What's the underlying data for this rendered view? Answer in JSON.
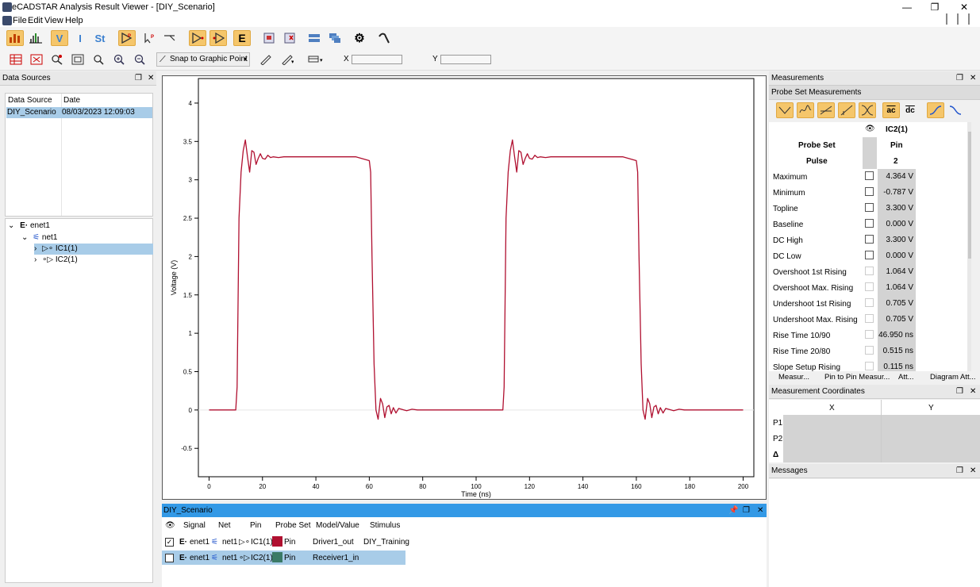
{
  "window": {
    "title": "eCADSTAR Analysis Result Viewer - [DIY_Scenario]",
    "controls": [
      "—",
      "❐",
      "✕"
    ]
  },
  "menu": [
    "File",
    "Edit",
    "View",
    "Help"
  ],
  "toolbar": {
    "snap_label": "Snap to Graphic Point",
    "x_label": "X",
    "y_label": "Y",
    "v_label": "V",
    "i_label": "I",
    "st_label": "St",
    "e_label": "E"
  },
  "data_sources": {
    "title": "Data Sources",
    "headers": [
      "Data Source",
      "Date"
    ],
    "rows": [
      {
        "source": "DIY_Scenario",
        "date": "08/03/2023 12:09:03"
      }
    ]
  },
  "tree": {
    "root": "enet1",
    "net": "net1",
    "items": [
      "IC1(1)",
      "IC2(1)"
    ]
  },
  "chart_data": {
    "type": "line",
    "xlabel": "Time (ns)",
    "ylabel": "Voltage (V)",
    "xlim": [
      -4,
      204
    ],
    "ylim": [
      -0.87,
      4.32
    ],
    "xticks": [
      0,
      20,
      40,
      60,
      80,
      100,
      120,
      140,
      160,
      180,
      200
    ],
    "yticks": [
      -0.5,
      0,
      0.5,
      1,
      1.5,
      2,
      2.5,
      3,
      3.5,
      4
    ],
    "color": "#b01030",
    "series": [
      {
        "x": [
          0,
          10,
          10.5,
          11.2,
          12,
          12.8,
          13.6,
          14.4,
          15.2,
          16,
          16.8,
          17.6,
          18.4,
          19.2,
          20,
          21,
          22,
          23,
          24,
          26,
          28,
          30,
          40,
          55,
          60,
          60.5,
          61,
          61.8,
          62.5,
          63.3,
          64.2,
          65,
          65.8,
          66.6,
          67.4,
          68.2,
          69,
          70,
          71,
          72,
          74,
          76,
          78,
          80,
          100,
          110,
          110.5,
          111.2,
          112,
          112.8,
          113.6,
          114.4,
          115.2,
          116,
          116.8,
          117.6,
          118.4,
          119.2,
          120,
          121,
          122,
          123,
          124,
          126,
          128,
          130,
          140,
          155,
          160,
          160.5,
          161,
          161.8,
          162.5,
          163.3,
          164.2,
          165,
          165.8,
          166.6,
          167.4,
          168.2,
          169,
          170,
          171,
          172,
          174,
          176,
          178,
          180,
          200
        ],
        "y": [
          0,
          0,
          0.3,
          2.5,
          3.1,
          3.38,
          3.52,
          3.3,
          3.1,
          3.38,
          3.36,
          3.2,
          3.28,
          3.34,
          3.28,
          3.27,
          3.32,
          3.29,
          3.3,
          3.29,
          3.3,
          3.3,
          3.3,
          3.3,
          3.25,
          3.1,
          2.0,
          0.6,
          0.0,
          -0.12,
          0.15,
          0.08,
          -0.1,
          0.04,
          0.06,
          -0.05,
          0.03,
          -0.04,
          0.02,
          0.01,
          -0.01,
          0.01,
          0,
          0,
          0,
          0,
          0.3,
          2.5,
          3.1,
          3.38,
          3.52,
          3.3,
          3.1,
          3.38,
          3.36,
          3.2,
          3.28,
          3.34,
          3.28,
          3.27,
          3.32,
          3.29,
          3.3,
          3.29,
          3.3,
          3.3,
          3.3,
          3.3,
          3.25,
          3.1,
          2.0,
          0.6,
          0.0,
          -0.12,
          0.15,
          0.08,
          -0.1,
          0.04,
          0.06,
          -0.05,
          0.03,
          -0.04,
          0.02,
          0.01,
          -0.01,
          0.01,
          0,
          0,
          0
        ]
      }
    ]
  },
  "bottom_panel": {
    "title": "DIY_Scenario",
    "headers": [
      "Signal",
      "Net",
      "Pin",
      "Probe Set",
      "Model/Value",
      "Stimulus"
    ],
    "rows": [
      {
        "signal": "enet1",
        "net": "net1",
        "pin": "IC1(1)",
        "probe": "Pin",
        "model": "Driver1_out",
        "stimulus": "DIY_Training",
        "checked": true,
        "swatch": "#b01030"
      },
      {
        "signal": "enet1",
        "net": "net1",
        "pin": "IC2(1)",
        "probe": "Pin",
        "model": "Receiver1_in",
        "stimulus": "",
        "checked": false,
        "swatch": "#3a7a66"
      }
    ]
  },
  "measurements": {
    "title": "Measurements",
    "subtitle": "Probe Set Measurements",
    "column": "IC2(1)",
    "probe_set_label": "Probe Set",
    "probe_set_value": "Pin",
    "pulse_label": "Pulse",
    "pulse_value": "2",
    "icon_ac": "ac",
    "icon_dc": "dc",
    "rows": [
      {
        "label": "Maximum",
        "value": "4.364 V"
      },
      {
        "label": "Minimum",
        "value": "-0.787 V"
      },
      {
        "label": "Topline",
        "value": "3.300 V"
      },
      {
        "label": "Baseline",
        "value": "0.000 V"
      },
      {
        "label": "DC High",
        "value": "3.300 V"
      },
      {
        "label": "DC Low",
        "value": "0.000 V"
      },
      {
        "label": "Overshoot 1st Rising",
        "value": "1.064 V"
      },
      {
        "label": "Overshoot Max. Rising",
        "value": "1.064 V"
      },
      {
        "label": "Undershoot 1st Rising",
        "value": "0.705 V"
      },
      {
        "label": "Undershoot Max. Rising",
        "value": "0.705 V"
      },
      {
        "label": "Rise Time 10/90",
        "value": "46.950 ns"
      },
      {
        "label": "Rise Time 20/80",
        "value": "0.515 ns"
      },
      {
        "label": "Slope Setup Rising",
        "value": "0.115 ns"
      }
    ],
    "tabs": [
      "Measur...",
      "Pin to Pin Measur...",
      "Att...",
      "Diagram Att..."
    ]
  },
  "coords": {
    "title": "Measurement Coordinates",
    "headers": [
      "X",
      "Y"
    ],
    "rows": [
      "P1",
      "P2",
      "Δ"
    ]
  },
  "messages": {
    "title": "Messages"
  }
}
